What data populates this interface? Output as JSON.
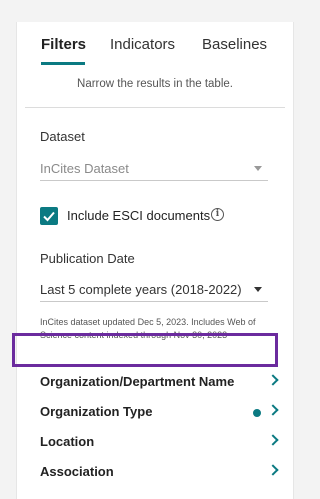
{
  "tabs": [
    {
      "label": "Filters",
      "active": true
    },
    {
      "label": "Indicators",
      "active": false
    },
    {
      "label": "Baselines",
      "active": false
    }
  ],
  "hint": "Narrow the results in the table.",
  "dataset": {
    "label": "Dataset",
    "value": "InCites Dataset",
    "disabled": true
  },
  "esci": {
    "label": "Include ESCI documents",
    "checked": true
  },
  "publication_date": {
    "label": "Publication Date",
    "value": "Last 5 complete years (2018-2022)"
  },
  "dataset_note": "InCites dataset updated Dec 5, 2023. Includes Web of Science content indexed through Nov 30, 2023",
  "filter_rows": [
    {
      "label": "Organization/Department Name",
      "highlighted": true,
      "indicator": false
    },
    {
      "label": "Organization Type",
      "highlighted": false,
      "indicator": true
    },
    {
      "label": "Location",
      "highlighted": false,
      "indicator": false
    },
    {
      "label": "Association",
      "highlighted": false,
      "indicator": false
    }
  ],
  "colors": {
    "accent": "#0b7a82",
    "highlight": "#6b2b9e"
  }
}
